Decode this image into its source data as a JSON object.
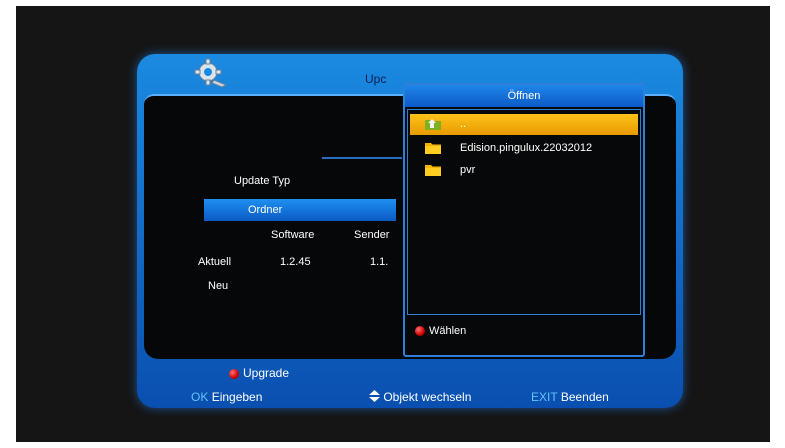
{
  "window": {
    "title_partial": "Upc",
    "update_typ_label": "Update Typ",
    "ordner_label": "Ordner",
    "columns": {
      "software": "Software",
      "sender": "Sender"
    },
    "rows": {
      "aktuell_label": "Aktuell",
      "aktuell_software": "1.2.45",
      "aktuell_sender": "1.1.",
      "neu_label": "Neu"
    },
    "upgrade_label": "Upgrade"
  },
  "footer": {
    "ok_key": "OK",
    "ok_action": "Eingeben",
    "move_action": "Objekt wechseln",
    "exit_key": "EXIT",
    "exit_action": "Beenden"
  },
  "dialog": {
    "title": "Öffnen",
    "items": [
      {
        "label": "..",
        "icon": "folder-up-icon",
        "selected": true
      },
      {
        "label": "Edision.pingulux.22032012",
        "icon": "folder-icon",
        "selected": false
      },
      {
        "label": "pvr",
        "icon": "folder-icon",
        "selected": false
      }
    ],
    "select_label": "Wählen"
  },
  "colors": {
    "accent_blue": "#1a8ae0",
    "highlight": "#ffc21a",
    "red_button": "#d00000",
    "key_cyan": "#5fc4ff"
  }
}
